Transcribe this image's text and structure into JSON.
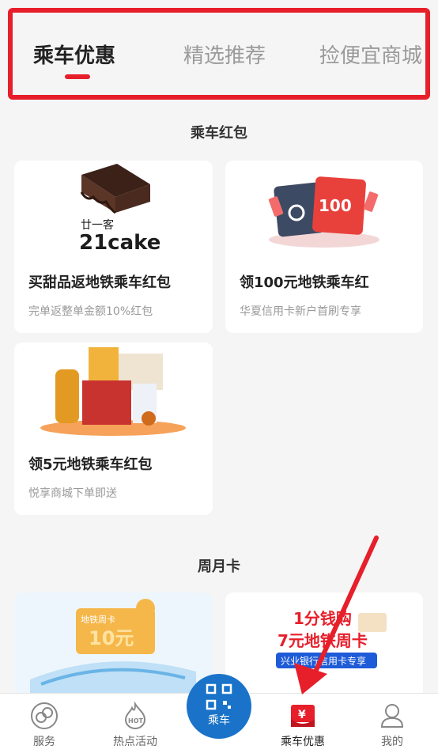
{
  "tabs": [
    {
      "label": "乘车优惠",
      "active": true
    },
    {
      "label": "精选推荐",
      "active": false
    },
    {
      "label": "捡便宜商城",
      "active": false
    }
  ],
  "sections": {
    "red_packet": "乘车红包",
    "period_card": "周月卡"
  },
  "cards": [
    {
      "title": "买甜品返地铁乘车红包",
      "subtitle": "完单返整单金额10%红包",
      "image": "21cake-logo",
      "logo_text": "廿一客",
      "logo_brand": "21cake"
    },
    {
      "title": "领100元地铁乘车红",
      "subtitle": "华夏信用卡新户首刷专享",
      "image": "red-packet-cards",
      "amount": "100"
    },
    {
      "title": "领5元地铁乘车红包",
      "subtitle": "悦享商城下单即送",
      "image": "product-bundle"
    }
  ],
  "period_cards": [
    {
      "image": "metro-10-yuan-card",
      "tag": "地铁周卡",
      "price": "10元"
    },
    {
      "image": "metro-week-card-promo",
      "line1": "1分钱购",
      "line2": "7元地铁周卡",
      "line3": "兴业银行信用卡专享"
    }
  ],
  "bottom_nav": {
    "service": "服务",
    "hot": "热点活动",
    "ride": "乘车",
    "coupon": "乘车优惠",
    "mine": "我的"
  },
  "colors": {
    "accent_red": "#e61f2a",
    "ride_blue": "#1a73c9"
  }
}
